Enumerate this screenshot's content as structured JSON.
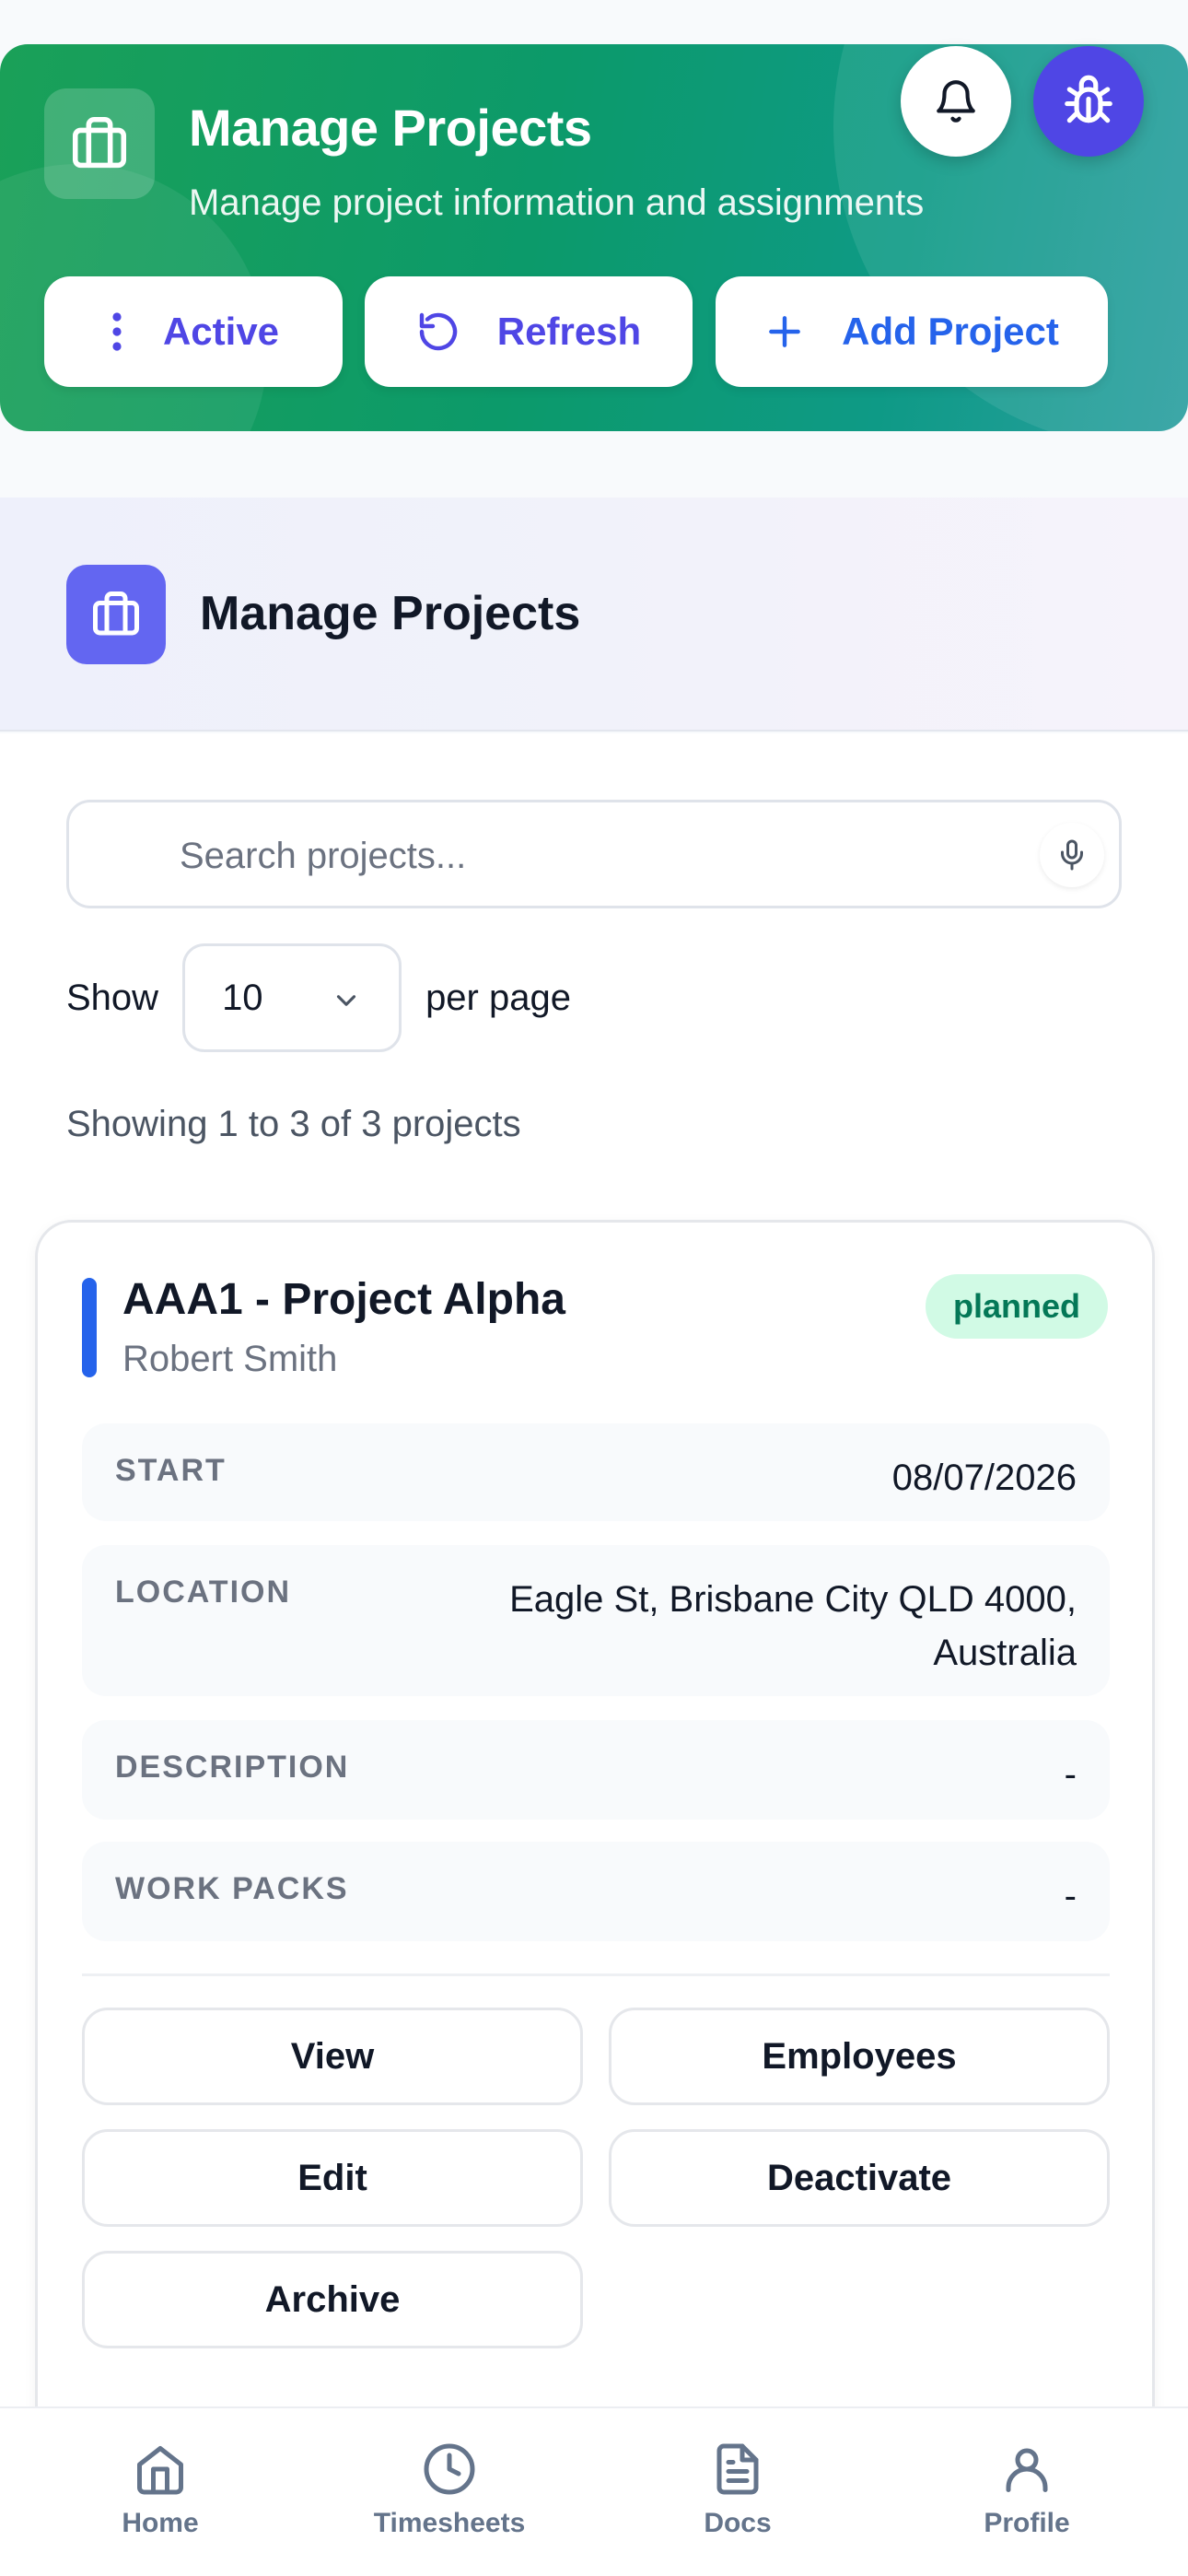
{
  "header": {
    "title": "Manage Projects",
    "subtitle": "Manage project information and assignments",
    "icon": "briefcase-icon",
    "buttons": {
      "active": "Active",
      "refresh": "Refresh",
      "add": "Add Project"
    }
  },
  "section": {
    "title": "Manage Projects",
    "icon": "briefcase-icon"
  },
  "search": {
    "placeholder": "Search projects..."
  },
  "pagination": {
    "show_label": "Show",
    "per_page_value": "10",
    "per_page_label": "per page",
    "summary": "Showing 1 to 3 of 3 projects"
  },
  "projects": [
    {
      "title": "AAA1 - Project Alpha",
      "owner": "Robert Smith",
      "status": "planned",
      "status_color": "#047857",
      "fields": {
        "start_label": "START",
        "start_value": "08/07/2026",
        "location_label": "LOCATION",
        "location_value_line1": "Eagle St, Brisbane City QLD 4000,",
        "location_value_line2": "Australia",
        "description_label": "DESCRIPTION",
        "description_value": "-",
        "workpacks_label": "WORK PACKS",
        "workpacks_value": "-"
      },
      "actions": {
        "view": "View",
        "employees": "Employees",
        "edit": "Edit",
        "deactivate": "Deactivate",
        "archive": "Archive"
      }
    }
  ],
  "nav": {
    "home": "Home",
    "timesheets": "Timesheets",
    "docs": "Docs",
    "profile": "Profile"
  },
  "colors": {
    "accent": "#4f46e5",
    "primary_blue": "#2563eb",
    "header_green": "#0c9a6a"
  }
}
